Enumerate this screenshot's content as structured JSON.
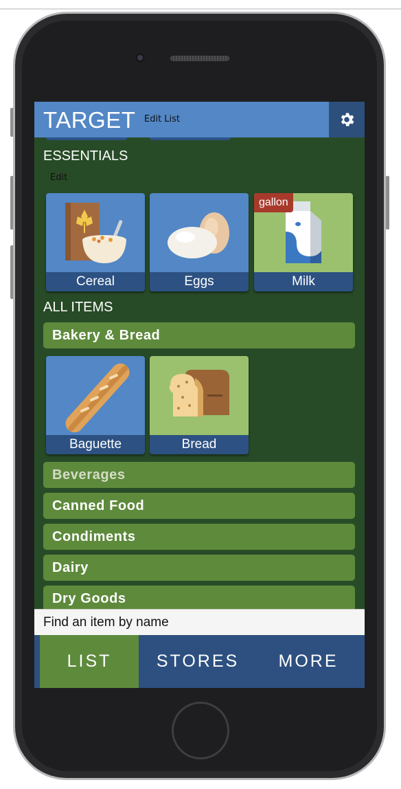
{
  "header": {
    "store_name": "TARGET",
    "edit_list_label": "Edit List",
    "settings_icon": "gear-icon"
  },
  "essentials": {
    "title": "ESSENTIALS",
    "edit_label": "Edit",
    "items": [
      {
        "label": "Cereal",
        "icon": "cereal-icon",
        "bg": "#5387c6"
      },
      {
        "label": "Eggs",
        "icon": "eggs-icon",
        "bg": "#5387c6"
      },
      {
        "label": "Milk",
        "icon": "milk-carton-icon",
        "bg": "#9bc16e",
        "badge": "gallon"
      }
    ]
  },
  "all_items": {
    "title": "ALL ITEMS",
    "categories": [
      {
        "name": "Bakery & Bread",
        "expanded": true,
        "items": [
          {
            "label": "Baguette",
            "icon": "baguette-icon",
            "bg": "#5387c6"
          },
          {
            "label": "Bread",
            "icon": "bread-icon",
            "bg": "#9bc16e"
          }
        ]
      },
      {
        "name": "Beverages"
      },
      {
        "name": "Canned Food"
      },
      {
        "name": "Condiments"
      },
      {
        "name": "Dairy"
      },
      {
        "name": "Dry Goods"
      }
    ]
  },
  "search": {
    "placeholder": "Find an item by name"
  },
  "tabs": [
    {
      "label": "LIST",
      "active": true
    },
    {
      "label": "STORES",
      "active": false
    },
    {
      "label": "MORE",
      "active": false
    }
  ],
  "colors": {
    "screen_bg": "#284b27",
    "header_blue": "#5387c6",
    "tab_blue": "#2d5080",
    "category_green": "#5e8a3c",
    "badge_red": "#a83a2c"
  }
}
